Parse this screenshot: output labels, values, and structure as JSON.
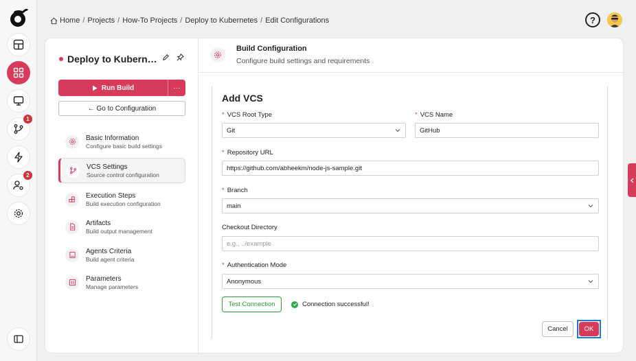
{
  "breadcrumb": {
    "items": [
      "Home",
      "Projects",
      "How-To Projects",
      "Deploy to Kubernetes",
      "Edit Configurations"
    ]
  },
  "header_right": {
    "help_label": "?"
  },
  "rail": {
    "badges": {
      "vcs": "1",
      "users": "2"
    }
  },
  "project": {
    "name": "Deploy to Kubernetes",
    "run_label": "Run Build",
    "more_label": "···",
    "goto_label": "← Go to Configuration"
  },
  "nav": [
    {
      "title": "Basic Information",
      "subtitle": "Configure basic build settings",
      "icon": "gear-icon"
    },
    {
      "title": "VCS Settings",
      "subtitle": "Source control configuration",
      "icon": "branch-icon"
    },
    {
      "title": "Execution Steps",
      "subtitle": "Build execution configuration",
      "icon": "blocks-icon"
    },
    {
      "title": "Artifacts",
      "subtitle": "Build output management",
      "icon": "file-icon"
    },
    {
      "title": "Agents Criteria",
      "subtitle": "Build agent criteria",
      "icon": "monitor-icon"
    },
    {
      "title": "Parameters",
      "subtitle": "Manage parameters",
      "icon": "sliders-icon"
    }
  ],
  "panel": {
    "title": "Build Configuration",
    "subtitle": "Configure build settings and requirements"
  },
  "form": {
    "title": "Add VCS",
    "root_type_label": "VCS Root Type",
    "root_type_value": "Git",
    "name_label": "VCS Name",
    "name_value": "GitHub",
    "repo_label": "Repository URL",
    "repo_value": "https://github.com/abheekm/node-js-sample.git",
    "branch_label": "Branch",
    "branch_value": "main",
    "checkout_label": "Checkout Directory",
    "checkout_placeholder": "e.g., ../example",
    "auth_label": "Authentication Mode",
    "auth_value": "Anonymous",
    "test_label": "Test Connection",
    "success_text": "Connection successful!",
    "cancel_label": "Cancel",
    "ok_label": "OK",
    "required_marker": "*"
  },
  "colors": {
    "accent": "#d63b5b",
    "success": "#2e9b3e",
    "focus": "#1f78d1"
  }
}
